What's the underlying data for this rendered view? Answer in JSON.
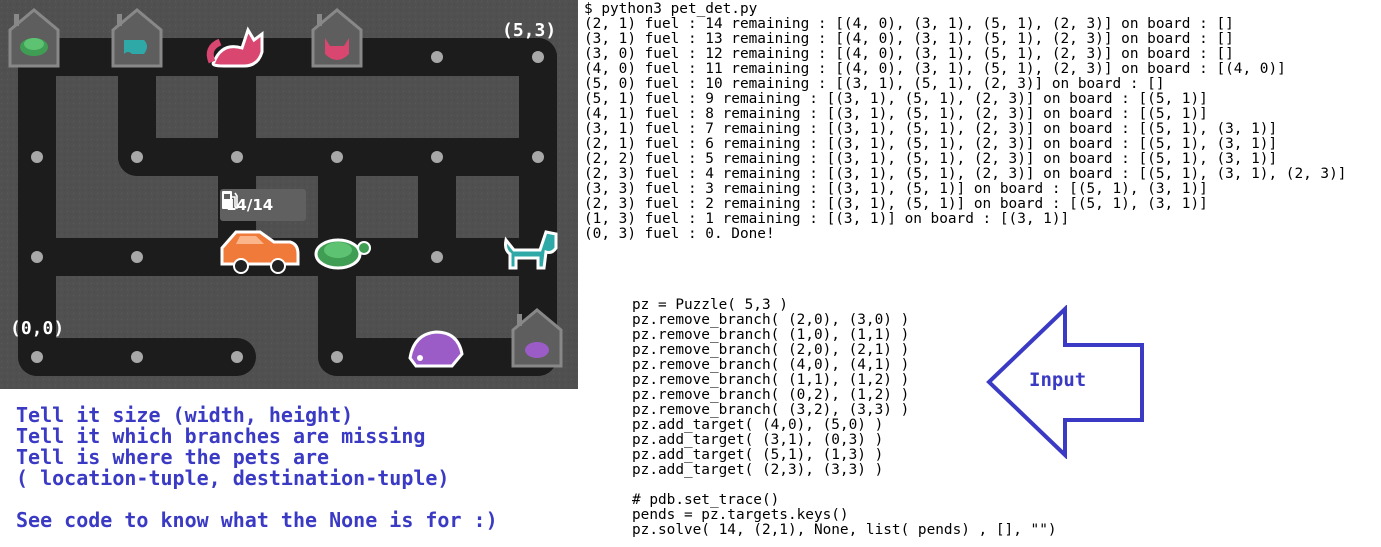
{
  "board": {
    "corner_top_right": "(5,3)",
    "corner_bottom_left": "(0,0)",
    "fuel_badge": "14/14",
    "icons": [
      "house-turtle-icon",
      "house-fish-icon",
      "cat-icon",
      "house-cat-icon",
      "car-icon",
      "turtle-icon",
      "dog-icon",
      "hedgehog-icon",
      "house-hedgehog-icon",
      "fuel-pump-icon"
    ]
  },
  "terminal": {
    "lines": [
      "$ python3 pet_det.py",
      "(2, 1) fuel : 14 remaining : [(4, 0), (3, 1), (5, 1), (2, 3)] on board : []",
      "(3, 1) fuel : 13 remaining : [(4, 0), (3, 1), (5, 1), (2, 3)] on board : []",
      "(3, 0) fuel : 12 remaining : [(4, 0), (3, 1), (5, 1), (2, 3)] on board : []",
      "(4, 0) fuel : 11 remaining : [(4, 0), (3, 1), (5, 1), (2, 3)] on board : [(4, 0)]",
      "(5, 0) fuel : 10 remaining : [(3, 1), (5, 1), (2, 3)] on board : []",
      "(5, 1) fuel : 9 remaining : [(3, 1), (5, 1), (2, 3)] on board : [(5, 1)]",
      "(4, 1) fuel : 8 remaining : [(3, 1), (5, 1), (2, 3)] on board : [(5, 1)]",
      "(3, 1) fuel : 7 remaining : [(3, 1), (5, 1), (2, 3)] on board : [(5, 1), (3, 1)]",
      "(2, 1) fuel : 6 remaining : [(3, 1), (5, 1), (2, 3)] on board : [(5, 1), (3, 1)]",
      "(2, 2) fuel : 5 remaining : [(3, 1), (5, 1), (2, 3)] on board : [(5, 1), (3, 1)]",
      "(2, 3) fuel : 4 remaining : [(3, 1), (5, 1), (2, 3)] on board : [(5, 1), (3, 1), (2, 3)]",
      "(3, 3) fuel : 3 remaining : [(3, 1), (5, 1)] on board : [(5, 1), (3, 1)]",
      "(2, 3) fuel : 2 remaining : [(3, 1), (5, 1)] on board : [(5, 1), (3, 1)]",
      "(1, 3) fuel : 1 remaining : [(3, 1)] on board : [(3, 1)]",
      "(0, 3) fuel : 0. Done!"
    ]
  },
  "code": {
    "lines": [
      "pz = Puzzle( 5,3 )",
      "pz.remove_branch( (2,0), (3,0) )",
      "pz.remove_branch( (1,0), (1,1) )",
      "pz.remove_branch( (2,0), (2,1) )",
      "pz.remove_branch( (4,0), (4,1) )",
      "pz.remove_branch( (1,1), (1,2) )",
      "pz.remove_branch( (0,2), (1,2) )",
      "pz.remove_branch( (3,2), (3,3) )",
      "pz.add_target( (4,0), (5,0) )",
      "pz.add_target( (3,1), (0,3) )",
      "pz.add_target( (5,1), (1,3) )",
      "pz.add_target( (2,3), (3,3) )",
      "",
      "# pdb.set_trace()",
      "pends = pz.targets.keys()",
      "pz.solve( 14, (2,1), None, list( pends) , [], \"\")"
    ]
  },
  "notes": {
    "lines": [
      "Tell it size (width, height)",
      "Tell it which branches are missing",
      "Tell is where the pets are",
      "( location-tuple, destination-tuple)",
      "",
      "See code to know what the None is for :)"
    ]
  },
  "arrow": {
    "label": "Input",
    "color": "#3a3ac4"
  },
  "colors": {
    "board_bg": "#4e4e4e",
    "road": "#1c1c1c",
    "dot": "#a8a8a8",
    "annotation": "#3a3ac4"
  }
}
